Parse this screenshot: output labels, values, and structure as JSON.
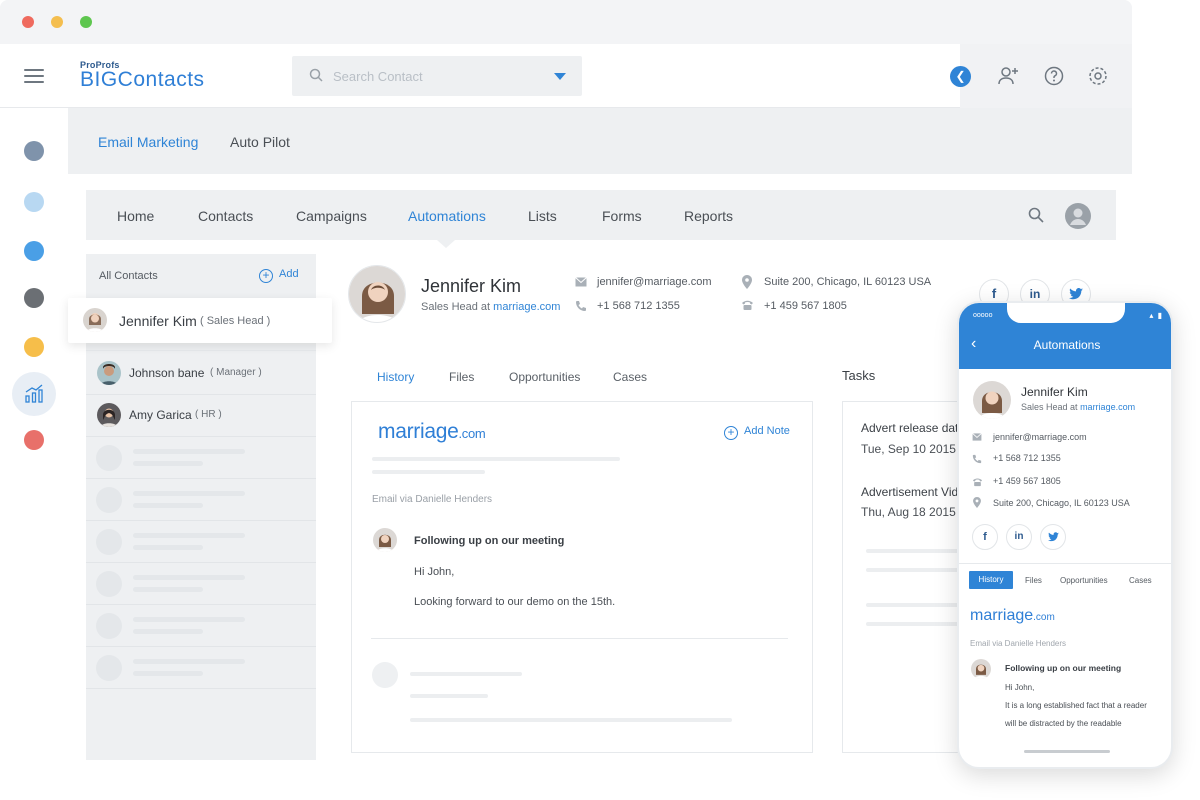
{
  "header": {
    "logo_top": "ProProfs",
    "logo_main": "BIGContacts",
    "search_placeholder": "Search Contact"
  },
  "subnav": {
    "tabs": [
      "Email Marketing",
      "Auto Pilot"
    ],
    "active": "Email Marketing"
  },
  "mainnav": {
    "items": [
      "Home",
      "Contacts",
      "Campaigns",
      "Automations",
      "Lists",
      "Forms",
      "Reports"
    ],
    "active": "Automations"
  },
  "contacts": {
    "header_label": "All Contacts",
    "add_label": "Add",
    "items": [
      {
        "name": "Jennifer Kim",
        "role": "( Sales Head )"
      },
      {
        "name": "Johnson bane",
        "role": "( Manager )"
      },
      {
        "name": "Amy Garica",
        "role": "( HR )"
      }
    ]
  },
  "profile": {
    "name": "Jennifer Kim",
    "title_prefix": "Sales Head at",
    "company_link": "marriage.com",
    "email": "jennifer@marriage.com",
    "phone": "+1 568 712 1355",
    "address": "Suite 200, Chicago, IL 60123 USA",
    "fax": "+1 459 567 1805",
    "social": [
      "f",
      "in",
      "t"
    ]
  },
  "detail_tabs": [
    "History",
    "Files",
    "Opportunities",
    "Cases"
  ],
  "history": {
    "brand_main": "marriage",
    "brand_suffix": ".com",
    "add_note": "Add Note",
    "via": "Email via Danielle Henders",
    "subject": "Following up on our meeting",
    "greeting": "Hi John,",
    "body": "Looking forward to our demo on the 15th."
  },
  "tasks": {
    "label": "Tasks",
    "items": [
      {
        "title": "Advert release date",
        "date": "Tue, Sep 10 2015"
      },
      {
        "title": "Advertisement Video",
        "date": "Thu, Aug 18 2015"
      }
    ]
  },
  "phone": {
    "status_left": "ooooo",
    "status_right": "▴ ▮",
    "title": "Automations",
    "name": "Jennifer Kim",
    "title_prefix": "Sales Head at",
    "company_link": "marriage.com",
    "email": "jennifer@marriage.com",
    "phone": "+1 568 712 1355",
    "fax": "+1 459 567 1805",
    "address": "Suite 200, Chicago, IL 60123 USA",
    "tabs": [
      "History",
      "Files",
      "Opportunities",
      "Cases"
    ],
    "brand_main": "marriage",
    "brand_suffix": ".com",
    "via": "Email via Danielle Henders",
    "subject": "Following up on our meeting",
    "greeting": "Hi John,",
    "body_1": "It is a long established fact that a reader",
    "body_2": "will be distracted by the readable"
  },
  "colors": {
    "accent": "#2f84d6",
    "brand": "#2f7fd6"
  }
}
